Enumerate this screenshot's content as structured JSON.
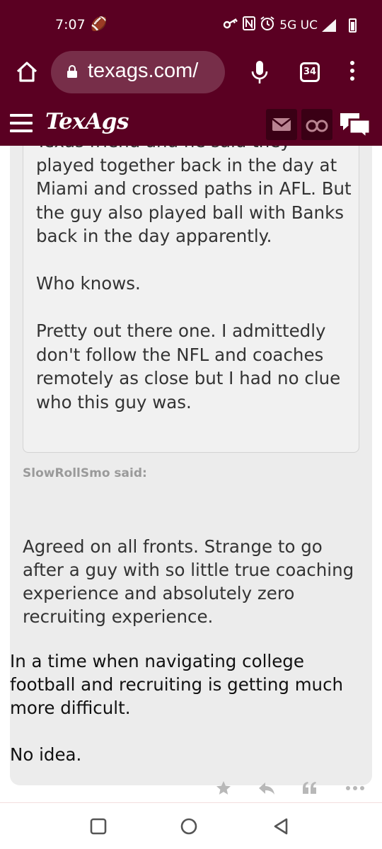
{
  "status": {
    "time": "7:07",
    "network": "5G UC"
  },
  "browser": {
    "url": "texags.com/",
    "tab_count": "34"
  },
  "site": {
    "logo": "TexAgs"
  },
  "quote_inner": {
    "partial_line": "Texas friend and he said they",
    "paragraphs": [
      "played together back in the day at Miami and crossed paths in AFL. But the guy also played ball with Banks back in the day apparently.",
      "Who knows.",
      "Pretty out there one. I admittedly don't follow the NFL and coaches remotely as close but I had no clue who this guy was."
    ]
  },
  "quote_outer": {
    "author_said": "SlowRollSmo said:",
    "text": "Agreed on all fronts. Strange to go after a guy with so little true coaching experience and absolutely zero recruiting experience."
  },
  "post": {
    "paragraphs": [
      "In a time when navigating college football and recruiting is getting much more difficult.",
      "No idea."
    ]
  },
  "colors": {
    "brand": "#5a0022",
    "header_button": "#3a0015",
    "quote_bg": "#ececec"
  },
  "icons": {
    "actions": [
      "star-icon",
      "reply-icon",
      "quote-icon",
      "more-icon"
    ],
    "nav": [
      "recents-icon",
      "home-icon",
      "back-icon"
    ]
  }
}
